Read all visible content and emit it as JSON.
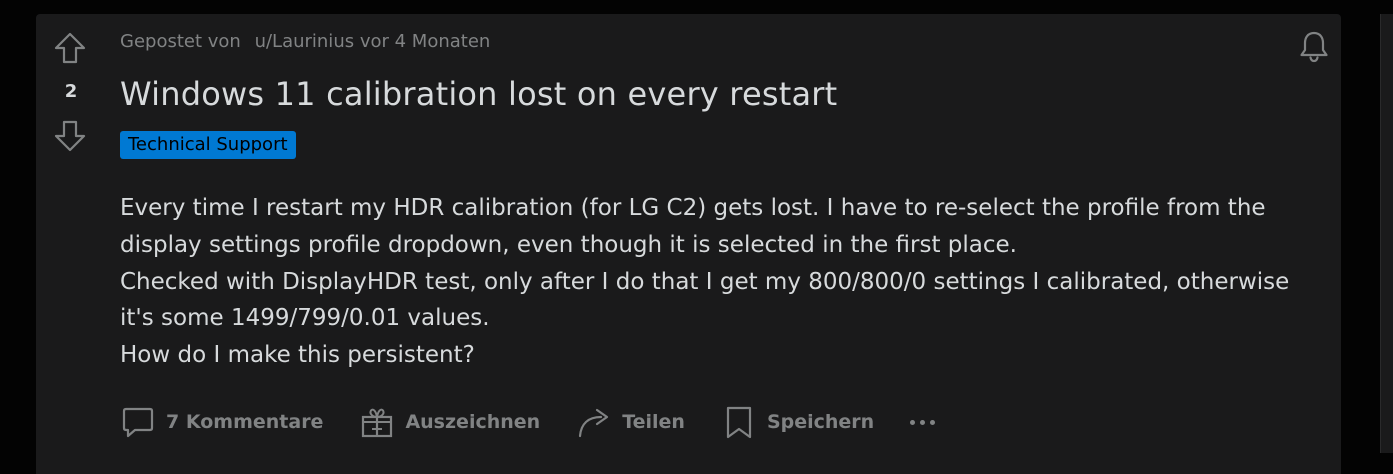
{
  "post": {
    "votes": "2",
    "meta_prefix": "Gepostet von",
    "author": "u/Laurinius",
    "age": "vor 4 Monaten",
    "title": "Windows 11 calibration lost on every restart",
    "flair": "Technical Support",
    "flair_color": "#0079d3",
    "body": [
      "Every time I restart my HDR calibration (for LG C2) gets lost. I have to re-select the profile from the display settings profile dropdown, even though it is selected in the first place.",
      "Checked with DisplayHDR test, only after I do that I get my 800/800/0 settings I calibrated, otherwise it's some 1499/799/0.01 values.",
      "How do I make this persistent?"
    ]
  },
  "actions": {
    "comments_label": "7 Kommentare",
    "award_label": "Auszeichnen",
    "share_label": "Teilen",
    "save_label": "Speichern",
    "more_icon": "ellipsis-icon"
  },
  "icons": {
    "upvote": "upvote-arrow-icon",
    "downvote": "downvote-arrow-icon",
    "bell": "bell-icon",
    "comment": "comment-bubble-icon",
    "award": "gift-icon",
    "share": "share-arrow-icon",
    "save": "bookmark-icon"
  },
  "colors": {
    "page_bg": "#030303",
    "card_bg": "#1a1a1b",
    "text": "#d7dadc",
    "muted": "#818384"
  }
}
